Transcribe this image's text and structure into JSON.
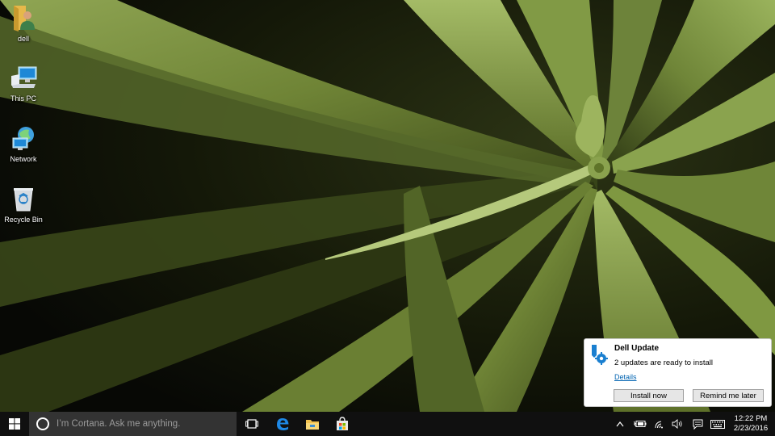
{
  "desktop": {
    "icons": [
      {
        "label": "dell",
        "icon": "user-folder-icon"
      },
      {
        "label": "This PC",
        "icon": "computer-icon"
      },
      {
        "label": "Network",
        "icon": "network-icon"
      },
      {
        "label": "Recycle Bin",
        "icon": "recycle-bin-icon"
      }
    ]
  },
  "taskbar": {
    "search_placeholder": "I’m Cortana. Ask me anything.",
    "pinned": [
      "task-view-icon",
      "edge-icon",
      "file-explorer-icon",
      "store-icon"
    ],
    "clock": {
      "time": "12:22 PM",
      "date": "2/23/2016"
    }
  },
  "toast": {
    "title": "Dell Update",
    "message": "2 updates are ready to install",
    "link": "Details",
    "primary_button": "Install now",
    "secondary_button": "Remind me later"
  },
  "colors": {
    "taskbar": "#101010",
    "search_box": "#333333",
    "link": "#0063b1",
    "wallpaper_leaf": "#7a8f3d"
  }
}
